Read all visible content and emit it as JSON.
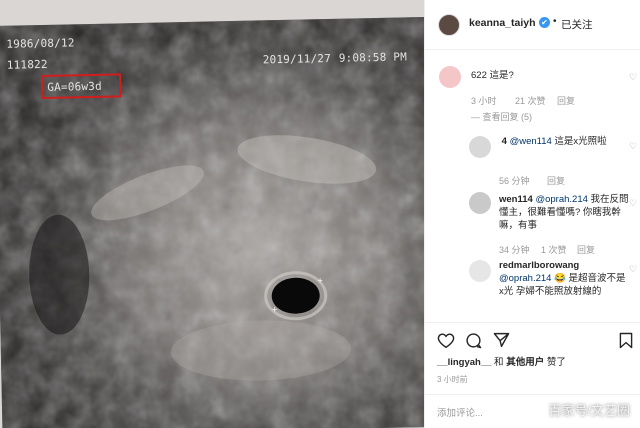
{
  "ultrasound": {
    "date_of_birth": "1986/08/12",
    "patient_id": "111822",
    "ga": "GA=06w3d",
    "scan_date": "2019/11/27",
    "scan_time": "9:08:58 PM"
  },
  "post": {
    "username": "keanna_taiyh",
    "verified": "✔",
    "separator": "•",
    "follow_status": "已关注"
  },
  "comments": [
    {
      "user_blurred": "    ",
      "text": "622 這是?",
      "time": "3 小时",
      "likes": "21 次赞",
      "reply": "回复",
      "view_replies": "查看回复 (5)"
    },
    {
      "user_blurred": "    ",
      "user_suffix": "4",
      "mention": "@wen114",
      "text": " 這是x光照啦",
      "time": "56 分钟",
      "reply": "回复"
    },
    {
      "user": "wen114",
      "mention": "@oprah.214",
      "text": " 我在反問懂主，很難看懂嗎? 你瞎我幹嘛，有事",
      "time": "34 分钟",
      "likes": "1 次赞",
      "reply": "回复"
    },
    {
      "user": "redmarlborowang",
      "mention": "@oprah.214",
      "text": " 😂 是超音波不是x光 孕婦不能照放射線的"
    }
  ],
  "likes_line": {
    "user1": "__lingyah__",
    "and": "和",
    "others": "其他用户",
    "liked": "赞了"
  },
  "timestamp": "3 小时前",
  "add_comment_placeholder": "添加评论...",
  "watermark": "百家号/文艺圈",
  "colors": {
    "ga_box": "#d21d1d",
    "link": "#003569",
    "verified": "#3897f0"
  }
}
